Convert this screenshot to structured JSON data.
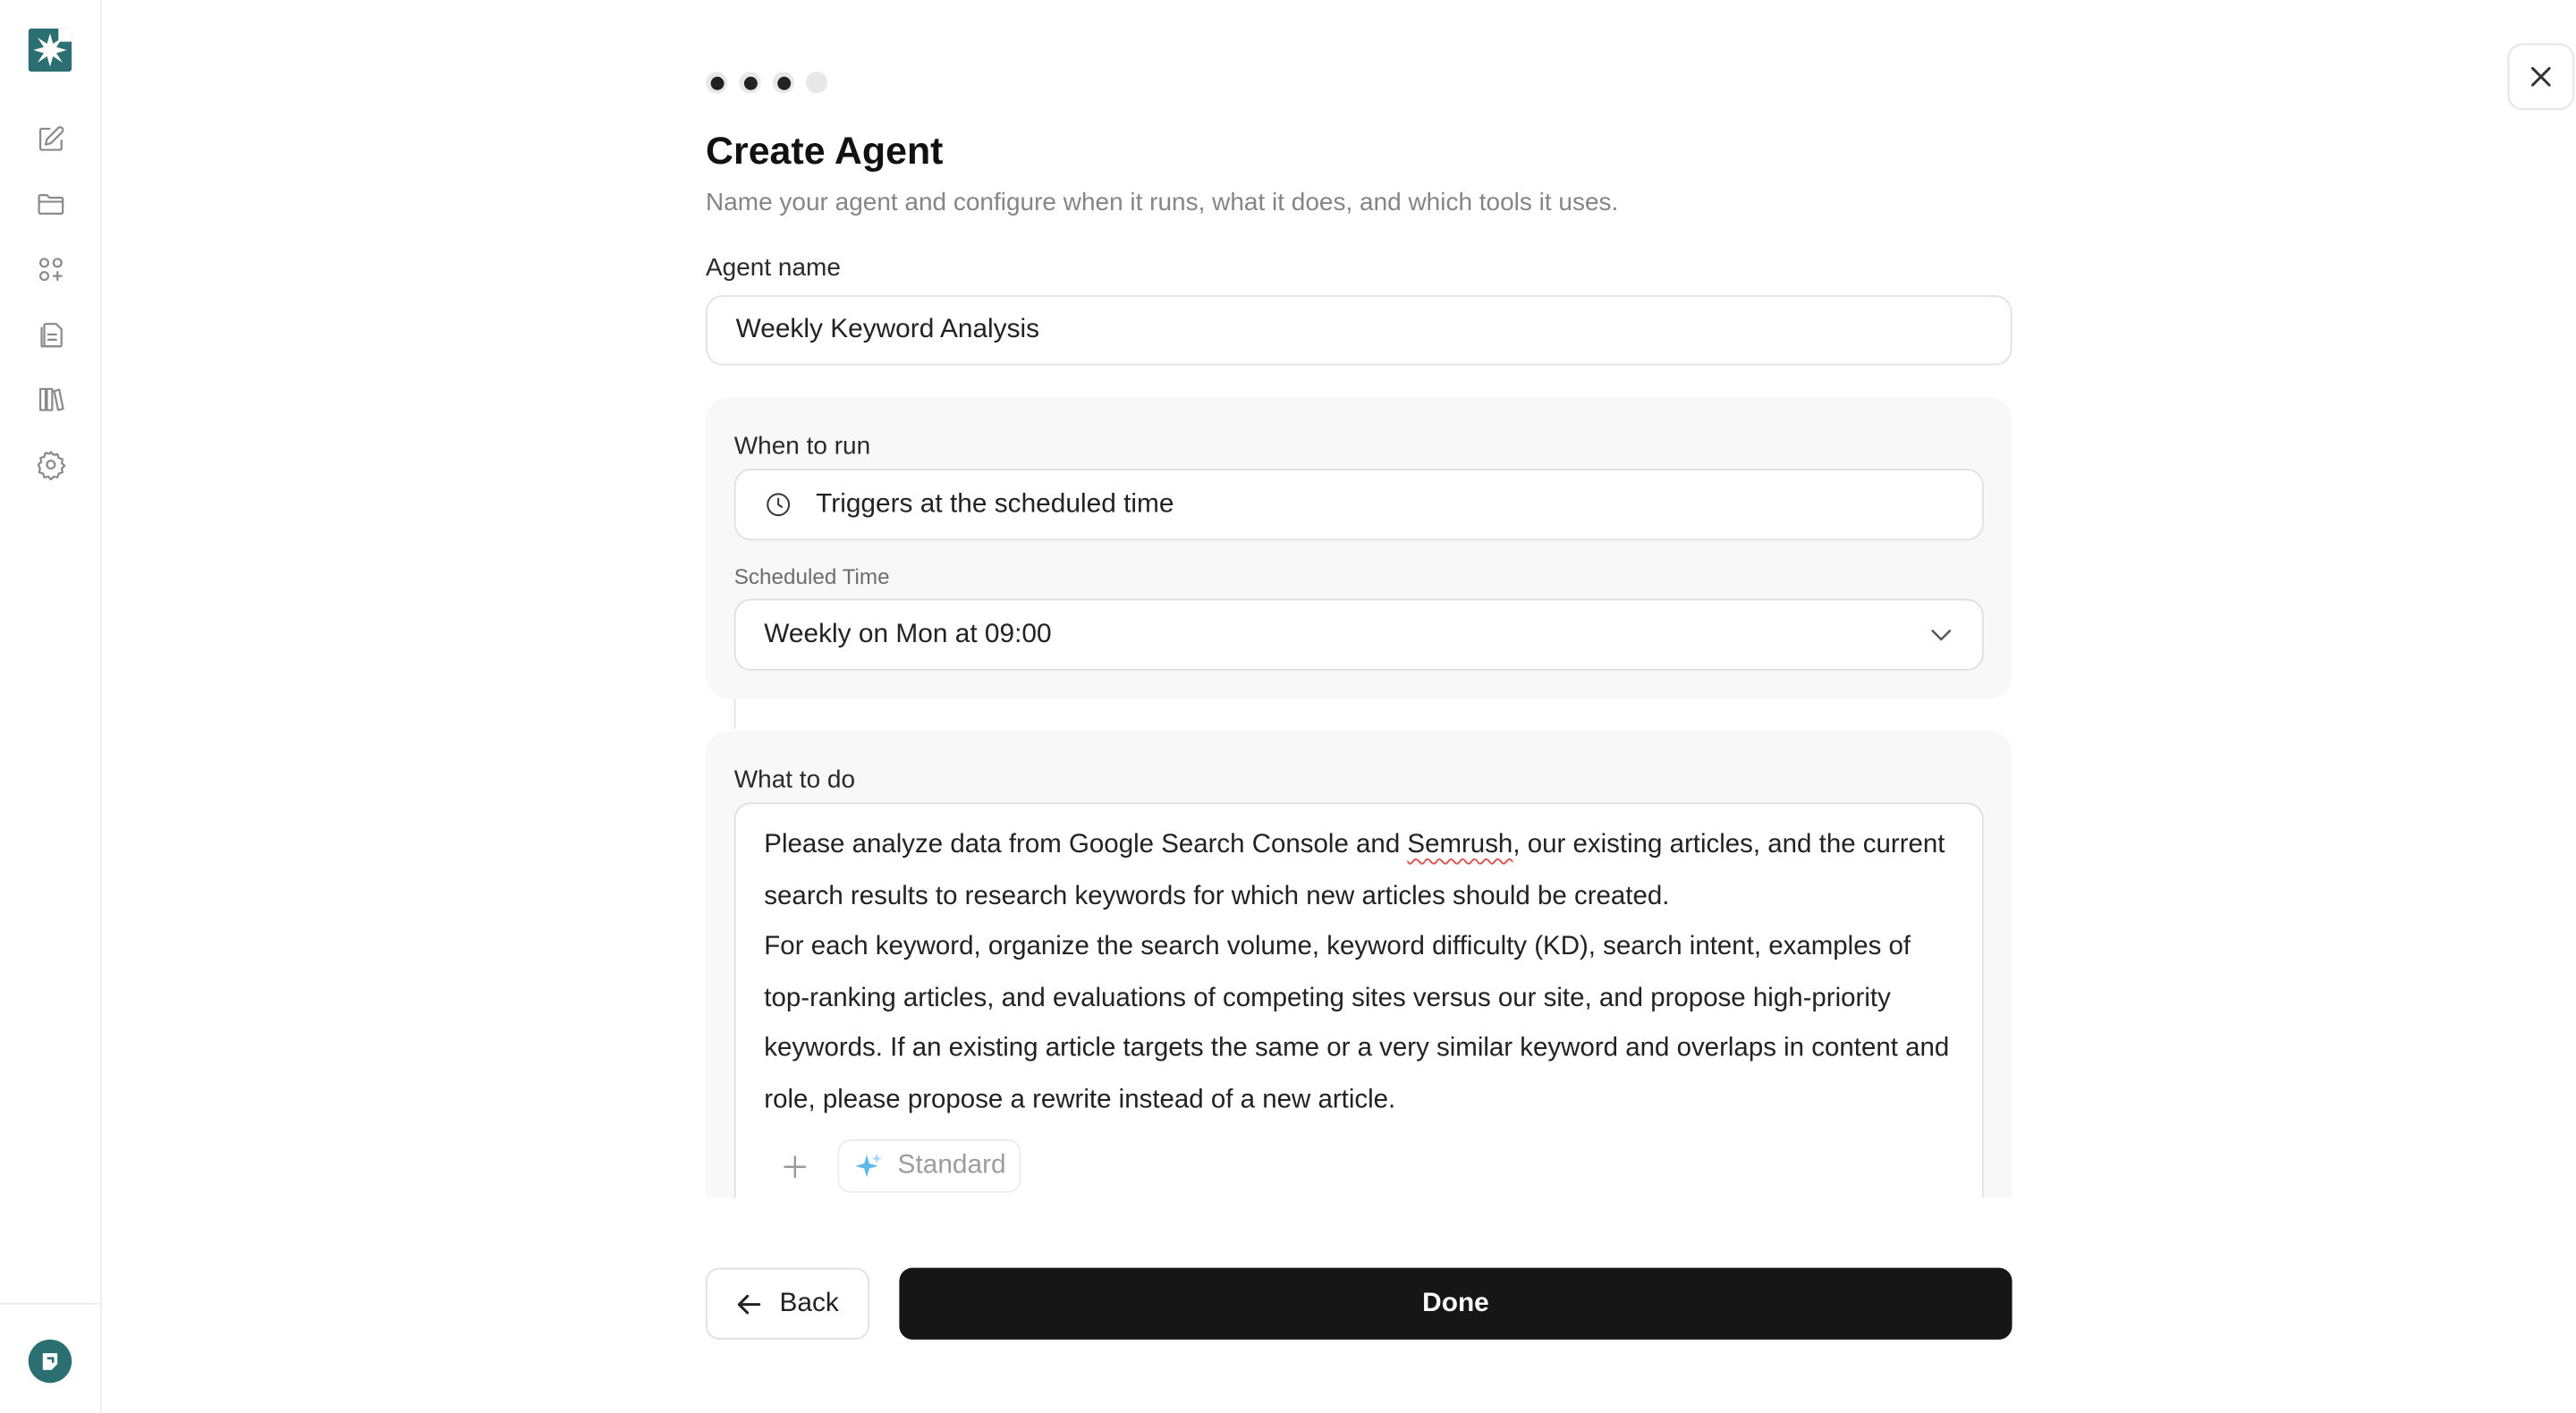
{
  "sidebar": {
    "logo_icon": "starburst-logo-icon",
    "brand_color": "#2c6f72",
    "items": [
      {
        "icon": "edit-icon"
      },
      {
        "icon": "folder-icon"
      },
      {
        "icon": "apps-icon"
      },
      {
        "icon": "document-icon"
      },
      {
        "icon": "library-icon"
      },
      {
        "icon": "gear-icon"
      }
    ],
    "avatar_icon": "user-avatar-icon"
  },
  "stepper": {
    "total": 4,
    "completed": 3
  },
  "header": {
    "title": "Create Agent",
    "subtitle": "Name your agent and configure when it runs, what it does, and which tools it uses."
  },
  "agent_name": {
    "label": "Agent name",
    "value": "Weekly Keyword Analysis"
  },
  "when_to_run": {
    "label": "When to run",
    "trigger_text": "Triggers at the scheduled time",
    "trigger_icon": "clock-icon",
    "scheduled_label": "Scheduled Time",
    "scheduled_value": "Weekly on Mon at 09:00"
  },
  "what_to_do": {
    "label": "What to do",
    "prompt_part1": "Please analyze data from Google Search Console and ",
    "prompt_misspelled": "Semrush",
    "prompt_part2": ", our existing articles, and the current search results to research keywords for which new articles should be created.\nFor each keyword, organize the search volume, keyword difficulty (KD), search intent, examples of top-ranking articles, and evaluations of competing sites versus our site, and propose high-priority keywords. If an existing article targets the same or a very similar keyword and overlaps in content and role, please propose a rewrite instead of a new article.",
    "model_label": "Standard",
    "model_icon": "sparkle-icon",
    "model_icon_color": "#5bb8e8"
  },
  "footer": {
    "back_label": "Back",
    "done_label": "Done",
    "done_color": "#161616"
  }
}
